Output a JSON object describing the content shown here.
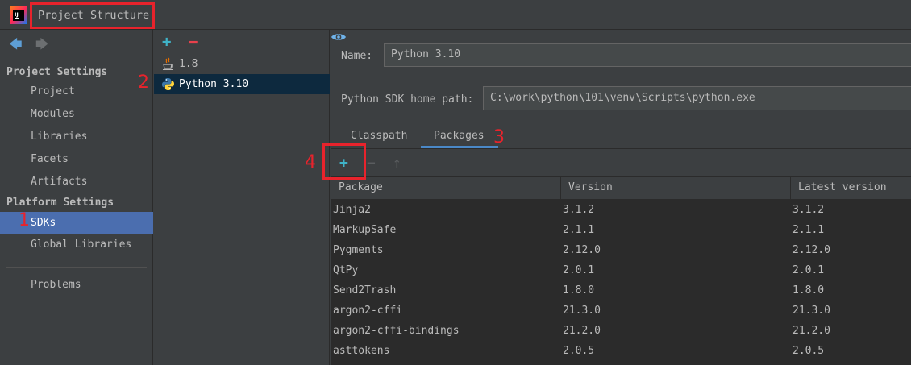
{
  "window": {
    "title": "Project Structure"
  },
  "nav": {
    "back_icon": "arrow-left-icon",
    "forward_icon": "arrow-right-icon",
    "project_settings_header": "Project Settings",
    "project_settings_items": [
      "Project",
      "Modules",
      "Libraries",
      "Facets",
      "Artifacts"
    ],
    "platform_settings_header": "Platform Settings",
    "platform_settings_items": [
      "SDKs",
      "Global Libraries"
    ],
    "selected": "SDKs",
    "other_items": [
      "Problems"
    ]
  },
  "sdk_list": {
    "add_label": "+",
    "remove_label": "−",
    "items": [
      {
        "name": "1.8",
        "icon": "java-icon"
      },
      {
        "name": "Python 3.10",
        "icon": "python-icon",
        "selected": true
      }
    ]
  },
  "details": {
    "name_label": "Name:",
    "name_value": "Python 3.10",
    "home_path_label": "Python SDK home path:",
    "home_path_value": "C:\\work\\python\\101\\venv\\Scripts\\python.exe",
    "tabs": [
      "Classpath",
      "Packages"
    ],
    "active_tab": "Packages",
    "toolbar": {
      "add": "+",
      "remove": "−",
      "up": "↑",
      "eye_icon": "eye-icon"
    },
    "table": {
      "columns": [
        "Package",
        "Version",
        "Latest version"
      ],
      "rows": [
        [
          "Jinja2",
          "3.1.2",
          "3.1.2"
        ],
        [
          "MarkupSafe",
          "2.1.1",
          "2.1.1"
        ],
        [
          "Pygments",
          "2.12.0",
          "2.12.0"
        ],
        [
          "QtPy",
          "2.0.1",
          "2.0.1"
        ],
        [
          "Send2Trash",
          "1.8.0",
          "1.8.0"
        ],
        [
          "argon2-cffi",
          "21.3.0",
          "21.3.0"
        ],
        [
          "argon2-cffi-bindings",
          "21.2.0",
          "21.2.0"
        ],
        [
          "asttokens",
          "2.0.5",
          "2.0.5"
        ]
      ]
    }
  },
  "annotations": [
    "1",
    "2",
    "3",
    "4"
  ],
  "colors": {
    "annotation_red": "#e8232c",
    "selection_blue": "#4b6eaf",
    "sdk_selection": "#0d293e",
    "add_teal": "#3fb3c8",
    "remove_red": "#e8414c"
  }
}
